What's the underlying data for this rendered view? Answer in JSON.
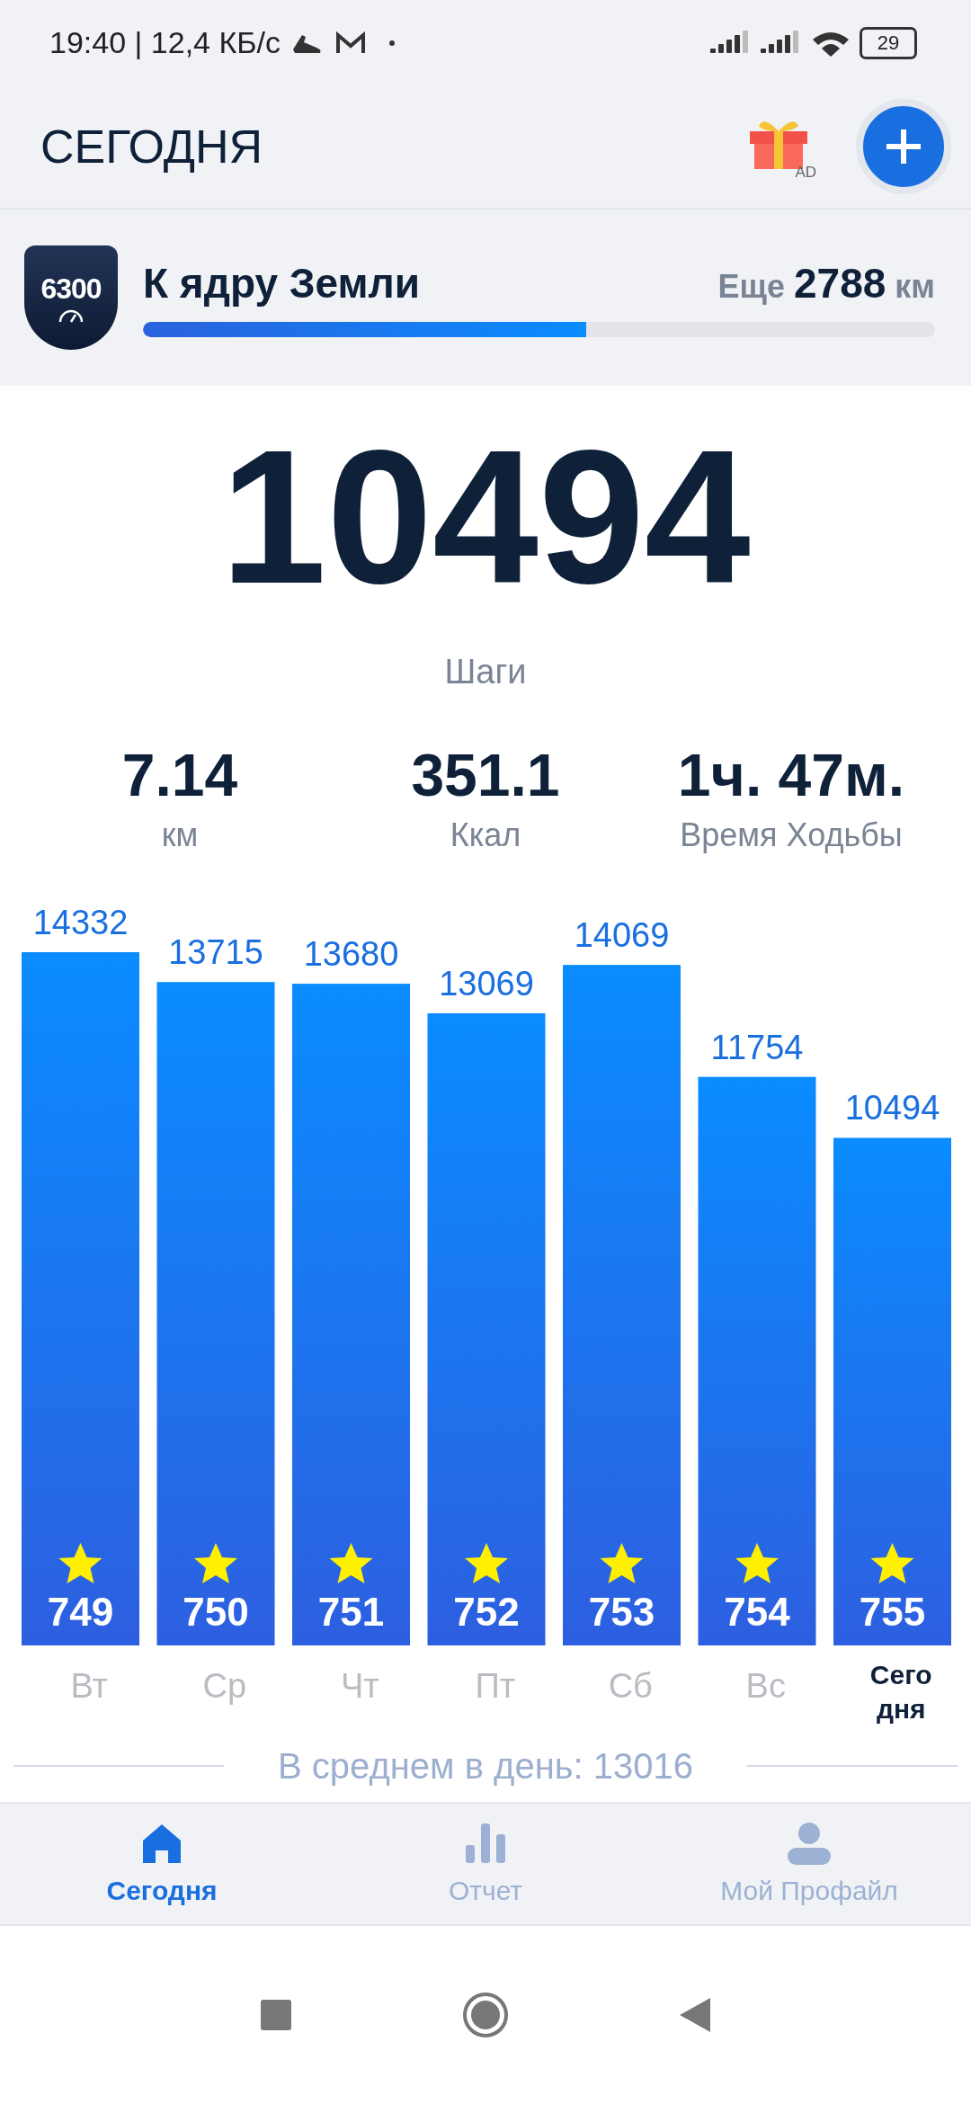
{
  "status_bar": {
    "time": "19:40 | 12,4 КБ/с",
    "battery": "29"
  },
  "header": {
    "title": "СЕГОДНЯ",
    "ad_label": "AD"
  },
  "goal": {
    "badge": "6300",
    "title": "К ядру Земли",
    "remaining_label": "Еще",
    "remaining_value": "2788",
    "remaining_unit": "км",
    "level": 0.56
  },
  "steps": {
    "value": "10494",
    "label": "Шаги"
  },
  "stats": [
    {
      "value": "7.14",
      "label": "км"
    },
    {
      "value": "351.1",
      "label": "Ккал"
    },
    {
      "value": "1ч. 47м.",
      "label": "Время Ходьбы"
    }
  ],
  "week": {
    "chart_data": {
      "type": "bar",
      "categories": [
        "Вт",
        "Ср",
        "Чт",
        "Пт",
        "Сб",
        "Вс",
        "Сегодня"
      ],
      "values": [
        14332,
        13715,
        13680,
        13069,
        14069,
        11754,
        10494
      ],
      "data_labels": true
    },
    "rewards": [
      "749",
      "750",
      "751",
      "752",
      "753",
      "754",
      "755"
    ],
    "average": "В среднем в день: 13016"
  },
  "tabs": [
    {
      "label": "Сегодня",
      "kind": "home",
      "selected": true
    },
    {
      "label": "Отчет",
      "kind": "report",
      "selected": false
    },
    {
      "label": "Мой Профайл",
      "kind": "profile",
      "selected": false
    }
  ]
}
